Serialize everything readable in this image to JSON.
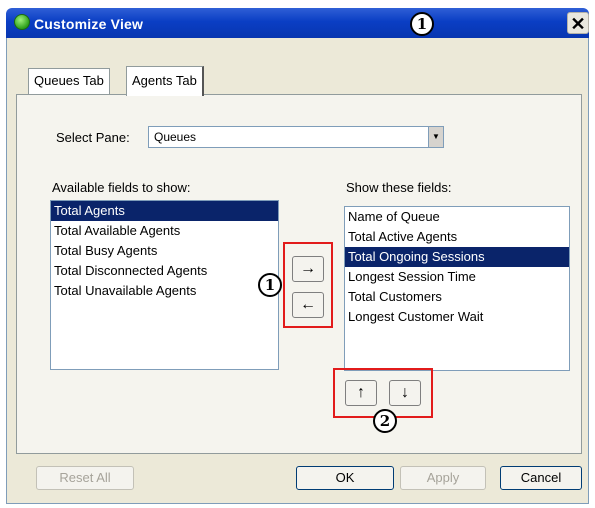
{
  "window": {
    "title": "Customize View",
    "close_label": "✕"
  },
  "tabs": [
    {
      "label": "Queues Tab",
      "active": false
    },
    {
      "label": "Agents Tab",
      "active": true
    }
  ],
  "select_pane": {
    "label": "Select Pane:",
    "value": "Queues"
  },
  "available": {
    "label": "Available fields to show:",
    "items": [
      "Total Agents",
      "Total Available Agents",
      "Total Busy Agents",
      "Total Disconnected Agents",
      "Total Unavailable Agents"
    ],
    "selected_index": 0
  },
  "shown": {
    "label": "Show these fields:",
    "items": [
      "Name of Queue",
      "Total Active Agents",
      "Total Ongoing Sessions",
      "Longest Session Time",
      "Total Customers",
      "Longest Customer Wait"
    ],
    "selected_index": 2
  },
  "move_buttons": {
    "add": "→",
    "remove": "←"
  },
  "order_buttons": {
    "up": "↑",
    "down": "↓"
  },
  "callouts": {
    "one": "1",
    "two": "2"
  },
  "footer": {
    "reset_all": "Reset All",
    "ok": "OK",
    "apply": "Apply",
    "cancel": "Cancel"
  },
  "colors": {
    "title_bar": "#0a3ec4",
    "selection": "#0a246a",
    "highlight_box": "#e21b1b"
  }
}
